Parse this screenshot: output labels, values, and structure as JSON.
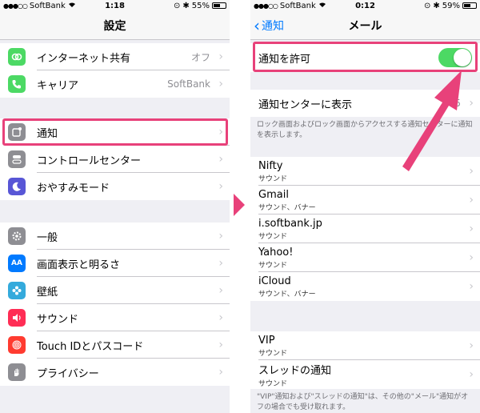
{
  "left": {
    "status": {
      "carrier": "SoftBank",
      "time": "1:18",
      "battery": "55%",
      "battery_level": 0.55
    },
    "title": "設定",
    "items": [
      {
        "label": "インターネット共有",
        "value": "オフ",
        "icon": "link-icon",
        "color": "#4cd964"
      },
      {
        "label": "キャリア",
        "value": "SoftBank",
        "icon": "phone-icon",
        "color": "#4cd964"
      },
      {
        "label": "通知",
        "value": "",
        "icon": "notification-icon",
        "color": "#8e8e93"
      },
      {
        "label": "コントロールセンター",
        "value": "",
        "icon": "toggles-icon",
        "color": "#8e8e93"
      },
      {
        "label": "おやすみモード",
        "value": "",
        "icon": "moon-icon",
        "color": "#5856d6"
      },
      {
        "label": "一般",
        "value": "",
        "icon": "gear-icon",
        "color": "#8e8e93"
      },
      {
        "label": "画面表示と明るさ",
        "value": "",
        "icon": "text-size-icon",
        "color": "#007aff"
      },
      {
        "label": "壁紙",
        "value": "",
        "icon": "flower-icon",
        "color": "#34aadc"
      },
      {
        "label": "サウンド",
        "value": "",
        "icon": "speaker-icon",
        "color": "#ff2d55"
      },
      {
        "label": "Touch IDとパスコード",
        "value": "",
        "icon": "fingerprint-icon",
        "color": "#ff3b30"
      },
      {
        "label": "プライバシー",
        "value": "",
        "icon": "hand-icon",
        "color": "#8e8e93"
      }
    ]
  },
  "right": {
    "status": {
      "carrier": "SoftBank",
      "time": "0:12",
      "battery": "59%",
      "battery_level": 0.59
    },
    "back_label": "通知",
    "title": "メール",
    "allow_label": "通知を許可",
    "allow_on": true,
    "center_label": "通知センターに表示",
    "center_value": "5",
    "center_note": "ロック画面およびロック画面からアクセスする通知センターに通知を表示します。",
    "accounts": [
      {
        "name": "Nifty",
        "sub": "サウンド"
      },
      {
        "name": "Gmail",
        "sub": "サウンド、バナー"
      },
      {
        "name": "i.softbank.jp",
        "sub": "サウンド"
      },
      {
        "name": "Yahoo!",
        "sub": "サウンド"
      },
      {
        "name": "iCloud",
        "sub": "サウンド、バナー"
      }
    ],
    "extras": [
      {
        "name": "VIP",
        "sub": "サウンド"
      },
      {
        "name": "スレッドの通知",
        "sub": "サウンド"
      }
    ],
    "bottom_note": "\"VIP\"通知および\"スレッドの通知\"は、その他の\"メール\"通知がオフの場合でも受け取れます。"
  },
  "colors": {
    "highlight": "#e8417a",
    "toggle_on": "#4cd964",
    "link": "#007aff"
  }
}
